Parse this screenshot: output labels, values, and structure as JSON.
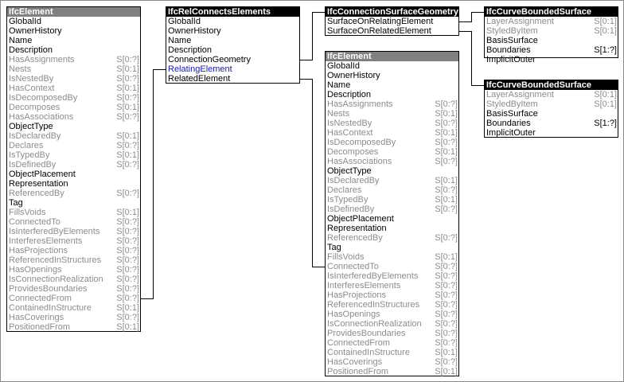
{
  "entities": {
    "left_element": {
      "name": "IfcElement",
      "attributes": [
        {
          "name": "GlobalId",
          "card": "",
          "style": "normal"
        },
        {
          "name": "OwnerHistory",
          "card": "",
          "style": "normal"
        },
        {
          "name": "Name",
          "card": "",
          "style": "normal"
        },
        {
          "name": "Description",
          "card": "",
          "style": "normal"
        },
        {
          "name": "HasAssignments",
          "card": "S[0:?]",
          "style": "inverse"
        },
        {
          "name": "Nests",
          "card": "S[0:1]",
          "style": "inverse"
        },
        {
          "name": "IsNestedBy",
          "card": "S[0:?]",
          "style": "inverse"
        },
        {
          "name": "HasContext",
          "card": "S[0:1]",
          "style": "inverse"
        },
        {
          "name": "IsDecomposedBy",
          "card": "S[0:?]",
          "style": "inverse"
        },
        {
          "name": "Decomposes",
          "card": "S[0:1]",
          "style": "inverse"
        },
        {
          "name": "HasAssociations",
          "card": "S[0:?]",
          "style": "inverse"
        },
        {
          "name": "ObjectType",
          "card": "",
          "style": "normal"
        },
        {
          "name": "IsDeclaredBy",
          "card": "S[0:1]",
          "style": "inverse"
        },
        {
          "name": "Declares",
          "card": "S[0:?]",
          "style": "inverse"
        },
        {
          "name": "IsTypedBy",
          "card": "S[0:1]",
          "style": "inverse"
        },
        {
          "name": "IsDefinedBy",
          "card": "S[0:?]",
          "style": "inverse"
        },
        {
          "name": "ObjectPlacement",
          "card": "",
          "style": "normal"
        },
        {
          "name": "Representation",
          "card": "",
          "style": "normal"
        },
        {
          "name": "ReferencedBy",
          "card": "S[0:?]",
          "style": "inverse"
        },
        {
          "name": "Tag",
          "card": "",
          "style": "normal"
        },
        {
          "name": "FillsVoids",
          "card": "S[0:1]",
          "style": "inverse"
        },
        {
          "name": "ConnectedTo",
          "card": "S[0:?]",
          "style": "inverse"
        },
        {
          "name": "IsInterferedByElements",
          "card": "S[0:?]",
          "style": "inverse"
        },
        {
          "name": "InterferesElements",
          "card": "S[0:?]",
          "style": "inverse"
        },
        {
          "name": "HasProjections",
          "card": "S[0:?]",
          "style": "inverse"
        },
        {
          "name": "ReferencedInStructures",
          "card": "S[0:?]",
          "style": "inverse"
        },
        {
          "name": "HasOpenings",
          "card": "S[0:?]",
          "style": "inverse"
        },
        {
          "name": "IsConnectionRealization",
          "card": "S[0:?]",
          "style": "inverse"
        },
        {
          "name": "ProvidesBoundaries",
          "card": "S[0:?]",
          "style": "inverse"
        },
        {
          "name": "ConnectedFrom",
          "card": "S[0:?]",
          "style": "inverse"
        },
        {
          "name": "ContainedInStructure",
          "card": "S[0:1]",
          "style": "inverse"
        },
        {
          "name": "HasCoverings",
          "card": "S[0:?]",
          "style": "inverse"
        },
        {
          "name": "PositionedFrom",
          "card": "S[0:1]",
          "style": "inverse"
        }
      ]
    },
    "rel_connects": {
      "name": "IfcRelConnectsElements",
      "attributes": [
        {
          "name": "GlobalId",
          "card": "",
          "style": "normal"
        },
        {
          "name": "OwnerHistory",
          "card": "",
          "style": "normal"
        },
        {
          "name": "Name",
          "card": "",
          "style": "normal"
        },
        {
          "name": "Description",
          "card": "",
          "style": "normal"
        },
        {
          "name": "ConnectionGeometry",
          "card": "",
          "style": "normal"
        },
        {
          "name": "RelatingElement",
          "card": "",
          "style": "highlight"
        },
        {
          "name": "RelatedElement",
          "card": "",
          "style": "normal"
        }
      ]
    },
    "conn_surface": {
      "name": "IfcConnectionSurfaceGeometry",
      "attributes": [
        {
          "name": "SurfaceOnRelatingElement",
          "card": "",
          "style": "normal"
        },
        {
          "name": "SurfaceOnRelatedElement",
          "card": "",
          "style": "normal"
        }
      ]
    },
    "curve_bounded_1": {
      "name": "IfcCurveBoundedSurface",
      "attributes": [
        {
          "name": "LayerAssignment",
          "card": "S[0:1]",
          "style": "inverse"
        },
        {
          "name": "StyledByItem",
          "card": "S[0:1]",
          "style": "inverse"
        },
        {
          "name": "BasisSurface",
          "card": "",
          "style": "normal"
        },
        {
          "name": "Boundaries",
          "card": "S[1:?]",
          "style": "normal"
        },
        {
          "name": "ImplicitOuter",
          "card": "",
          "style": "normal"
        }
      ]
    },
    "curve_bounded_2": {
      "name": "IfcCurveBoundedSurface",
      "attributes": [
        {
          "name": "LayerAssignment",
          "card": "S[0:1]",
          "style": "inverse"
        },
        {
          "name": "StyledByItem",
          "card": "S[0:1]",
          "style": "inverse"
        },
        {
          "name": "BasisSurface",
          "card": "",
          "style": "normal"
        },
        {
          "name": "Boundaries",
          "card": "S[1:?]",
          "style": "normal"
        },
        {
          "name": "ImplicitOuter",
          "card": "",
          "style": "normal"
        }
      ]
    },
    "right_element": {
      "name": "IfcElement",
      "attributes": [
        {
          "name": "GlobalId",
          "card": "",
          "style": "normal"
        },
        {
          "name": "OwnerHistory",
          "card": "",
          "style": "normal"
        },
        {
          "name": "Name",
          "card": "",
          "style": "normal"
        },
        {
          "name": "Description",
          "card": "",
          "style": "normal"
        },
        {
          "name": "HasAssignments",
          "card": "S[0:?]",
          "style": "inverse"
        },
        {
          "name": "Nests",
          "card": "S[0:1]",
          "style": "inverse"
        },
        {
          "name": "IsNestedBy",
          "card": "S[0:?]",
          "style": "inverse"
        },
        {
          "name": "HasContext",
          "card": "S[0:1]",
          "style": "inverse"
        },
        {
          "name": "IsDecomposedBy",
          "card": "S[0:?]",
          "style": "inverse"
        },
        {
          "name": "Decomposes",
          "card": "S[0:1]",
          "style": "inverse"
        },
        {
          "name": "HasAssociations",
          "card": "S[0:?]",
          "style": "inverse"
        },
        {
          "name": "ObjectType",
          "card": "",
          "style": "normal"
        },
        {
          "name": "IsDeclaredBy",
          "card": "S[0:1]",
          "style": "inverse"
        },
        {
          "name": "Declares",
          "card": "S[0:?]",
          "style": "inverse"
        },
        {
          "name": "IsTypedBy",
          "card": "S[0:1]",
          "style": "inverse"
        },
        {
          "name": "IsDefinedBy",
          "card": "S[0:?]",
          "style": "inverse"
        },
        {
          "name": "ObjectPlacement",
          "card": "",
          "style": "normal"
        },
        {
          "name": "Representation",
          "card": "",
          "style": "normal"
        },
        {
          "name": "ReferencedBy",
          "card": "S[0:?]",
          "style": "inverse"
        },
        {
          "name": "Tag",
          "card": "",
          "style": "normal"
        },
        {
          "name": "FillsVoids",
          "card": "S[0:1]",
          "style": "inverse"
        },
        {
          "name": "ConnectedTo",
          "card": "S[0:?]",
          "style": "inverse"
        },
        {
          "name": "IsInterferedByElements",
          "card": "S[0:?]",
          "style": "inverse"
        },
        {
          "name": "InterferesElements",
          "card": "S[0:?]",
          "style": "inverse"
        },
        {
          "name": "HasProjections",
          "card": "S[0:?]",
          "style": "inverse"
        },
        {
          "name": "ReferencedInStructures",
          "card": "S[0:?]",
          "style": "inverse"
        },
        {
          "name": "HasOpenings",
          "card": "S[0:?]",
          "style": "inverse"
        },
        {
          "name": "IsConnectionRealization",
          "card": "S[0:?]",
          "style": "inverse"
        },
        {
          "name": "ProvidesBoundaries",
          "card": "S[0:?]",
          "style": "inverse"
        },
        {
          "name": "ConnectedFrom",
          "card": "S[0:?]",
          "style": "inverse"
        },
        {
          "name": "ContainedInStructure",
          "card": "S[0:1]",
          "style": "inverse"
        },
        {
          "name": "HasCoverings",
          "card": "S[0:?]",
          "style": "inverse"
        },
        {
          "name": "PositionedFrom",
          "card": "S[0:1]",
          "style": "inverse"
        }
      ]
    }
  }
}
